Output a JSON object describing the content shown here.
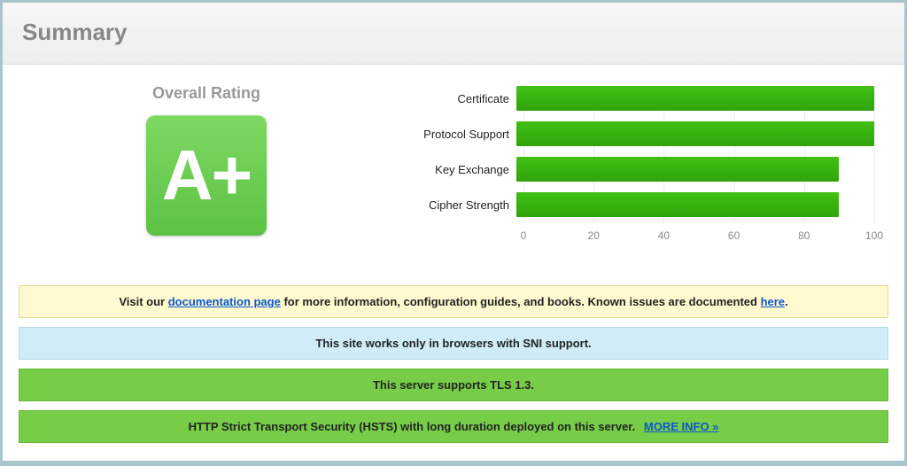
{
  "header": {
    "title": "Summary"
  },
  "rating": {
    "label": "Overall Rating",
    "grade": "A+"
  },
  "chart_data": {
    "type": "bar",
    "categories": [
      "Certificate",
      "Protocol Support",
      "Key Exchange",
      "Cipher Strength"
    ],
    "values": [
      100,
      100,
      90,
      90
    ],
    "xlim": [
      0,
      100
    ],
    "ticks": [
      0,
      20,
      40,
      60,
      80,
      100
    ],
    "title": "",
    "xlabel": "",
    "ylabel": ""
  },
  "banners": {
    "doc": {
      "prefix": "Visit our ",
      "link1": "documentation page",
      "mid": " for more information, configuration guides, and books. Known issues are documented ",
      "link2": "here",
      "suffix": "."
    },
    "sni": "This site works only in browsers with SNI support.",
    "tls": "This server supports TLS 1.3.",
    "hsts": {
      "text": "HTTP Strict Transport Security (HSTS) with long duration deployed on this server.",
      "more": "MORE INFO »"
    }
  }
}
